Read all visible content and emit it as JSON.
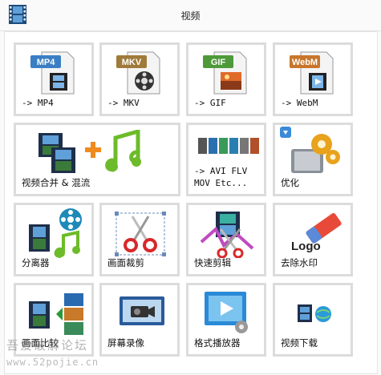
{
  "window": {
    "title": "视频"
  },
  "tiles": [
    {
      "label": "-> MP4",
      "badge": "MP4",
      "badge_color": "#3a7fc4"
    },
    {
      "label": "-> MKV",
      "badge": "MKV",
      "badge_color": "#a07a3a"
    },
    {
      "label": "-> GIF",
      "badge": "GIF",
      "badge_color": "#4e9a3a"
    },
    {
      "label": "-> WebM",
      "badge": "WebM",
      "badge_color": "#c8762b"
    },
    {
      "label": "视频合并 & 混流"
    },
    {
      "label": "-> AVI FLV\nMOV Etc..."
    },
    {
      "label": "优化"
    },
    {
      "label": "分离器"
    },
    {
      "label": "画面裁剪"
    },
    {
      "label": "快速剪辑"
    },
    {
      "label": "去除水印",
      "logo_text": "Logo"
    },
    {
      "label": "画面比较"
    },
    {
      "label": "屏幕录像"
    },
    {
      "label": "格式播放器"
    },
    {
      "label": "视频下载"
    }
  ],
  "watermark": {
    "line1": "吾爱破解论坛",
    "line2": "www.52pojie.cn"
  }
}
